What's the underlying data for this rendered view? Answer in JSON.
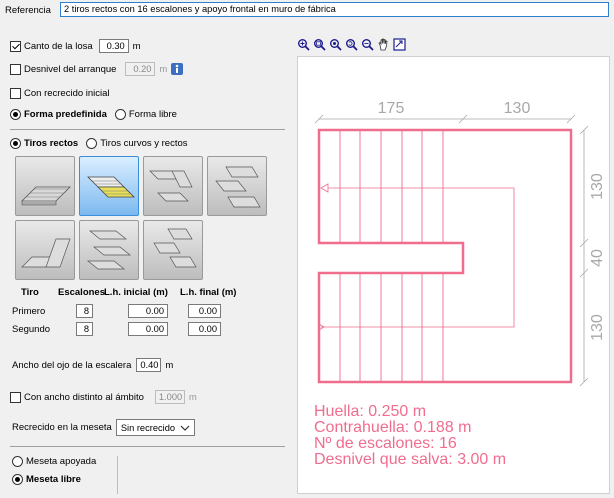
{
  "reference": {
    "label": "Referencia",
    "value": "2 tiros rectos con 16 escalones y apoyo frontal en muro de fábrica"
  },
  "slab": {
    "label": "Canto de la losa",
    "value": "0.30",
    "unit": "m",
    "checked": true
  },
  "start_gap": {
    "label": "Desnivel del arranque",
    "value": "0.20",
    "unit": "m",
    "checked": false
  },
  "initial_topping": {
    "label": "Con recrecido inicial",
    "checked": false
  },
  "shape": {
    "predefined": "Forma predefinida",
    "free": "Forma libre",
    "selected": "predefined"
  },
  "flight_type": {
    "straight": "Tiros rectos",
    "curved": "Tiros curvos y rectos",
    "selected": "straight"
  },
  "tiles": [
    {
      "name": "straight-single"
    },
    {
      "name": "two-straight-u",
      "selected": true
    },
    {
      "name": "three-flight"
    },
    {
      "name": "four-flight"
    },
    {
      "name": "l-flight"
    },
    {
      "name": "double-u"
    },
    {
      "name": "multi-flight"
    }
  ],
  "table": {
    "headers": [
      "Tiro",
      "Escalones",
      "L.h. inicial (m)",
      "L.h. final (m)"
    ],
    "rows": [
      {
        "label": "Primero",
        "steps": "8",
        "initial": "0.00",
        "final": "0.00"
      },
      {
        "label": "Segundo",
        "steps": "8",
        "initial": "0.00",
        "final": "0.00"
      }
    ]
  },
  "eye_width": {
    "label": "Ancho del ojo de la escalera",
    "value": "0.40",
    "unit": "m"
  },
  "ambit_width": {
    "label": "Con ancho distinto al ámbito",
    "value": "1.000",
    "unit": "m",
    "checked": false
  },
  "landing_topping": {
    "label": "Recrecido en la meseta",
    "value": "Sin recrecido"
  },
  "landing": {
    "supported": "Meseta apoyada",
    "free": "Meseta libre",
    "selected": "free"
  },
  "drawing": {
    "dims_top": [
      "175",
      "130"
    ],
    "dims_right": [
      "130",
      "40",
      "130"
    ],
    "line_color": "#f06d8e",
    "dim_color": "#a8a8a8"
  },
  "info": {
    "huella": "Huella: 0.250 m",
    "contrahuella": "Contrahuella: 0.188 m",
    "escalones": "Nº de escalones: 16",
    "desnivel": "Desnivel que salva: 3.00 m"
  },
  "toolbar_icons": [
    "zoom-extents-icon",
    "zoom-window-icon",
    "zoom-in-icon",
    "zoom-refresh-icon",
    "zoom-out-icon",
    "pan-hand-icon",
    "view-fit-icon"
  ]
}
